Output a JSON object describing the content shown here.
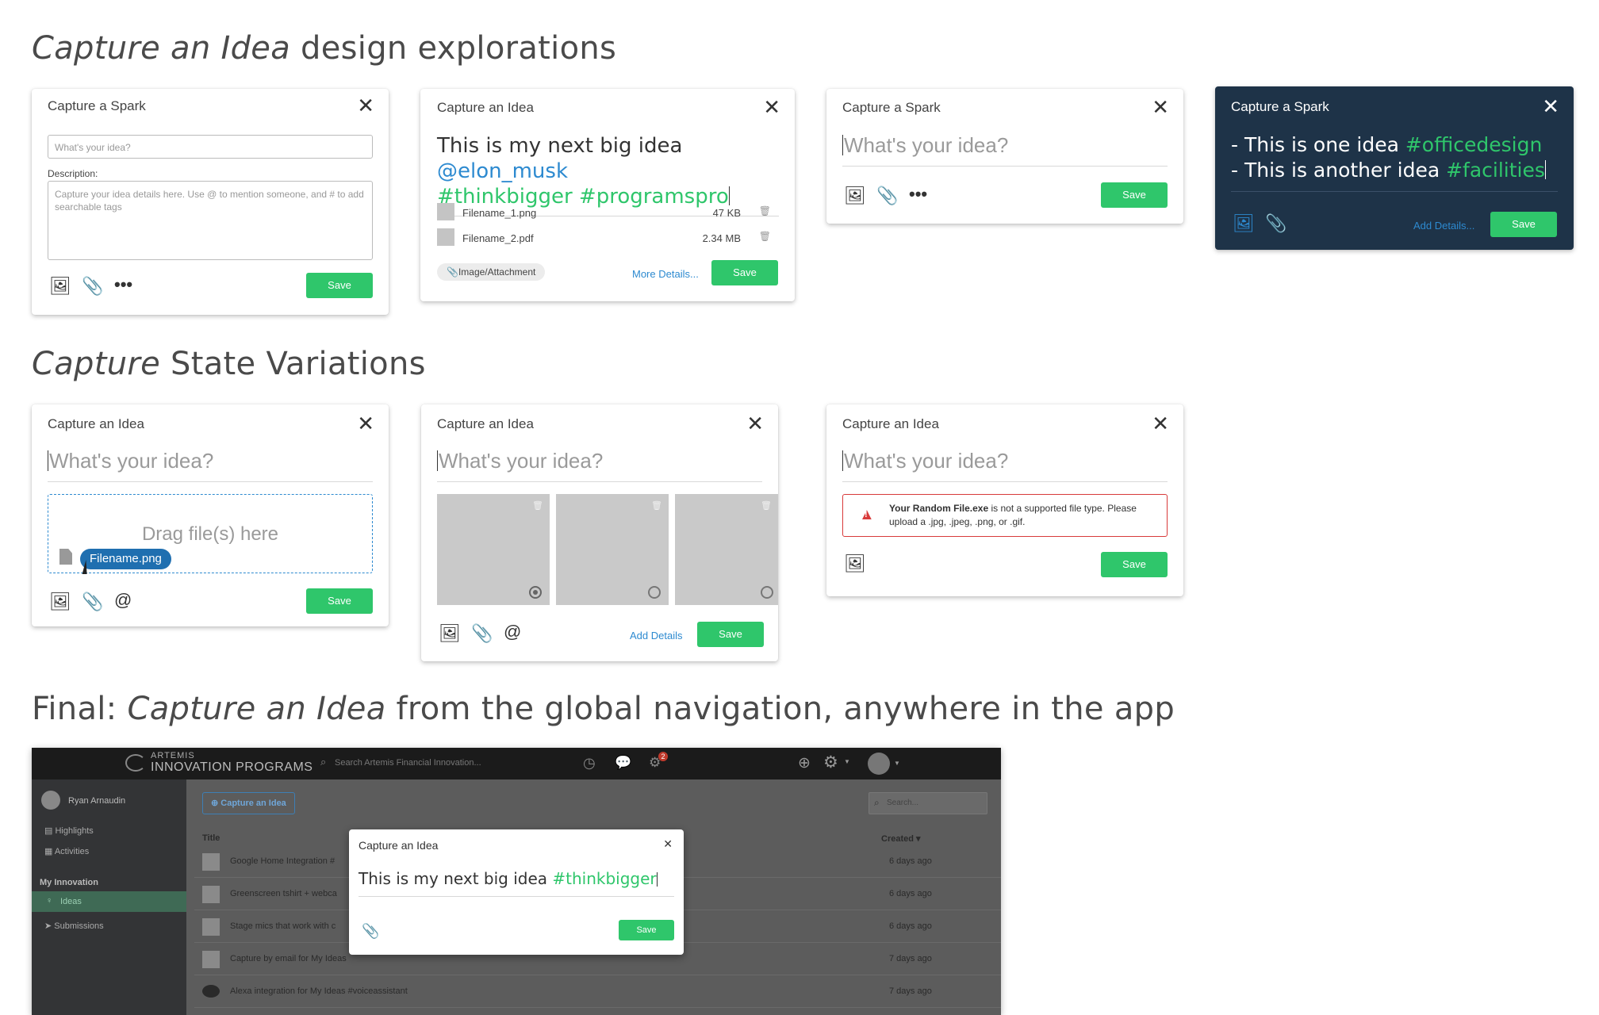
{
  "headings": {
    "h1_em": "Capture an Idea",
    "h1_rest": " design explorations",
    "h2_em": "Capture",
    "h2_rest": " State Variations",
    "h3_pre": "Final: ",
    "h3_em": "Capture an Idea",
    "h3_rest": " from the global navigation, anywhere in the app"
  },
  "card1": {
    "title": "Capture a Spark",
    "idea_placeholder": "What's your idea?",
    "description_label": "Description:",
    "description_placeholder": "Capture your idea details here. Use @ to mention someone, and # to add searchable tags",
    "save": "Save"
  },
  "card2": {
    "title": "Capture an Idea",
    "text_plain": "This is my next big idea ",
    "mention": "@elon_musk",
    "tag1": "#thinkbigger",
    "tag2": "#programspro",
    "files": [
      {
        "name": "Filename_1.png",
        "size": "47 KB"
      },
      {
        "name": "Filename_2.pdf",
        "size": "2.34 MB"
      }
    ],
    "chip": "Image/Attachment",
    "more_details": "More Details...",
    "save": "Save"
  },
  "card3": {
    "title": "Capture a Spark",
    "placeholder": "What's your idea?",
    "save": "Save"
  },
  "card4": {
    "title": "Capture a Spark",
    "line1_plain": "- This is one idea ",
    "line1_tag": "#officedesign",
    "line2_plain": "- This is another idea ",
    "line2_tag": "#facilities",
    "add_details": "Add Details...",
    "save": "Save"
  },
  "card5": {
    "title": "Capture an Idea",
    "placeholder": "What's your idea?",
    "drop_text": "Drag file(s) here",
    "drag_file": "Filename.png",
    "save": "Save"
  },
  "card6": {
    "title": "Capture an Idea",
    "placeholder": "What's your idea?",
    "add_details": "Add Details",
    "save": "Save"
  },
  "card7": {
    "title": "Capture an Idea",
    "placeholder": "What's your idea?",
    "error_bold": "Your Random File.exe",
    "error_rest": " is not a supported file type. Please upload a .jpg, .jpeg, .png, or .gif.",
    "save": "Save"
  },
  "app": {
    "brand_small": "ARTEMIS",
    "brand_big": "INNOVATION PROGRAMS",
    "search_placeholder": "Search Artemis Financial Innovation...",
    "notification_count": "2",
    "user_name": "Ryan Arnaudin",
    "nav": {
      "highlights": "Highlights",
      "activities": "Activities",
      "section": "My Innovation",
      "ideas": "Ideas",
      "submissions": "Submissions"
    },
    "capture_button": "Capture an Idea",
    "list_search": "Search...",
    "col_title": "Title",
    "col_created": "Created",
    "rows": [
      {
        "title": "Google Home Integration #",
        "created": "6 days ago"
      },
      {
        "title": "Greenscreen tshirt + webca",
        "created": "6 days ago"
      },
      {
        "title": "Stage mics that work with c",
        "created": "6 days ago"
      },
      {
        "title": "Capture by email for My Ideas",
        "created": "7 days ago"
      },
      {
        "title": "Alexa integration for My Ideas #voiceassistant",
        "created": "7 days ago"
      }
    ],
    "modal": {
      "title": "Capture an Idea",
      "text_plain": "This is my next big idea ",
      "tag": "#thinkbigger",
      "save": "Save"
    }
  }
}
